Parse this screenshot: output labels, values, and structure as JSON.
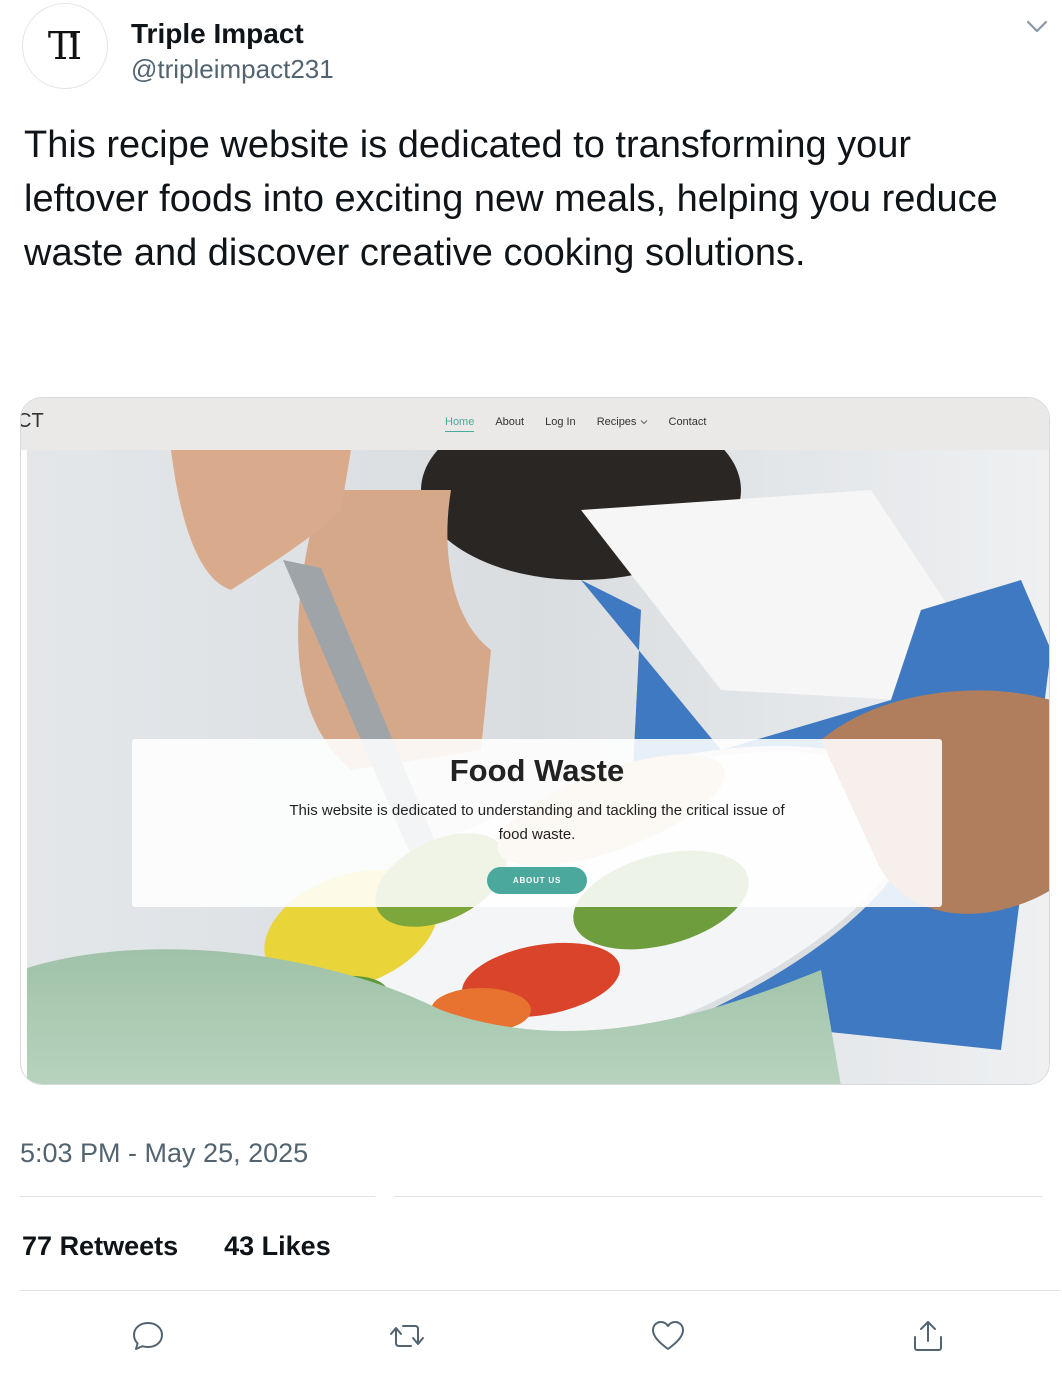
{
  "author": {
    "avatar_initials": "TI",
    "display_name": "Triple Impact",
    "handle": "@tripleimpact231"
  },
  "tweet": {
    "text": "This recipe website is dedicated to transforming your leftover foods into exciting new meals, helping you reduce waste and discover creative cooking solutions.",
    "timestamp": "5:03 PM - May 25, 2025"
  },
  "website": {
    "logo_text": "CT",
    "nav": [
      "Home",
      "About",
      "Log In",
      "Recipes",
      "Contact"
    ],
    "hero_title": "Food Waste",
    "hero_description": "This website is dedicated to understanding and tackling the critical issue of food waste.",
    "cta_label": "ABOUT US",
    "accent_color": "#4aa99c"
  },
  "stats": {
    "retweets_count": "77",
    "retweets_label": "Retweets",
    "likes_count": "43",
    "likes_label": "Likes"
  },
  "actions": [
    "reply-icon",
    "retweet-icon",
    "like-icon",
    "share-icon"
  ]
}
